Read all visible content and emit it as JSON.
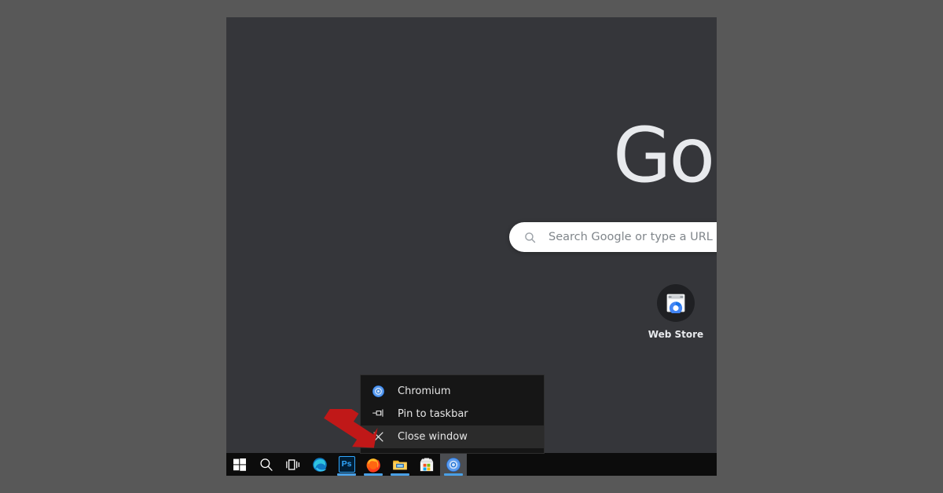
{
  "desktop": {
    "background_color": "#585858"
  },
  "browser": {
    "name": "Chromium",
    "theme": "dark",
    "window_background": "#35363a",
    "logo_text": "Goo",
    "logo_color": "#e8eaed",
    "search": {
      "icon": "search-icon",
      "placeholder": "Search Google or type a URL",
      "value": "",
      "background": "#ffffff",
      "placeholder_color": "#80868b"
    },
    "shortcuts": [
      {
        "label": "Web Store",
        "icon": "web-store-icon"
      }
    ]
  },
  "taskbar": {
    "background": "#0c0c0c",
    "accent_underline": "#4aa0e6",
    "items": [
      {
        "name": "start-button",
        "icon": "windows-logo-icon",
        "label": "Start",
        "running": false,
        "active": false
      },
      {
        "name": "search-button",
        "icon": "search-icon",
        "label": "Search",
        "running": false,
        "active": false
      },
      {
        "name": "task-view-button",
        "icon": "task-view-icon",
        "label": "Task View",
        "running": false,
        "active": false
      },
      {
        "name": "taskbar-item-edge",
        "icon": "edge-icon",
        "label": "Microsoft Edge",
        "running": true,
        "active": false
      },
      {
        "name": "taskbar-item-photoshop",
        "icon": "photoshop-icon",
        "label": "Ps",
        "running": true,
        "active": false
      },
      {
        "name": "taskbar-item-firefox",
        "icon": "firefox-icon",
        "label": "Firefox",
        "running": true,
        "active": false
      },
      {
        "name": "taskbar-item-file-explorer",
        "icon": "folder-icon",
        "label": "File Explorer",
        "running": true,
        "active": false
      },
      {
        "name": "taskbar-item-microsoft-store",
        "icon": "store-icon",
        "label": "Microsoft Store",
        "running": false,
        "active": false
      },
      {
        "name": "taskbar-item-chromium",
        "icon": "chromium-icon",
        "label": "Chromium",
        "running": true,
        "active": true
      }
    ]
  },
  "context_menu": {
    "background": "#161616",
    "highlight_background": "#2b2b2b",
    "items": [
      {
        "label": "Chromium",
        "icon": "chromium-icon",
        "highlighted": false
      },
      {
        "label": "Pin to taskbar",
        "icon": "pin-icon",
        "highlighted": false
      },
      {
        "label": "Close window",
        "icon": "close-x-icon",
        "highlighted": true
      }
    ]
  },
  "annotation": {
    "type": "arrow",
    "color": "#c01818",
    "direction": "down-right",
    "points_to": "Close window"
  }
}
